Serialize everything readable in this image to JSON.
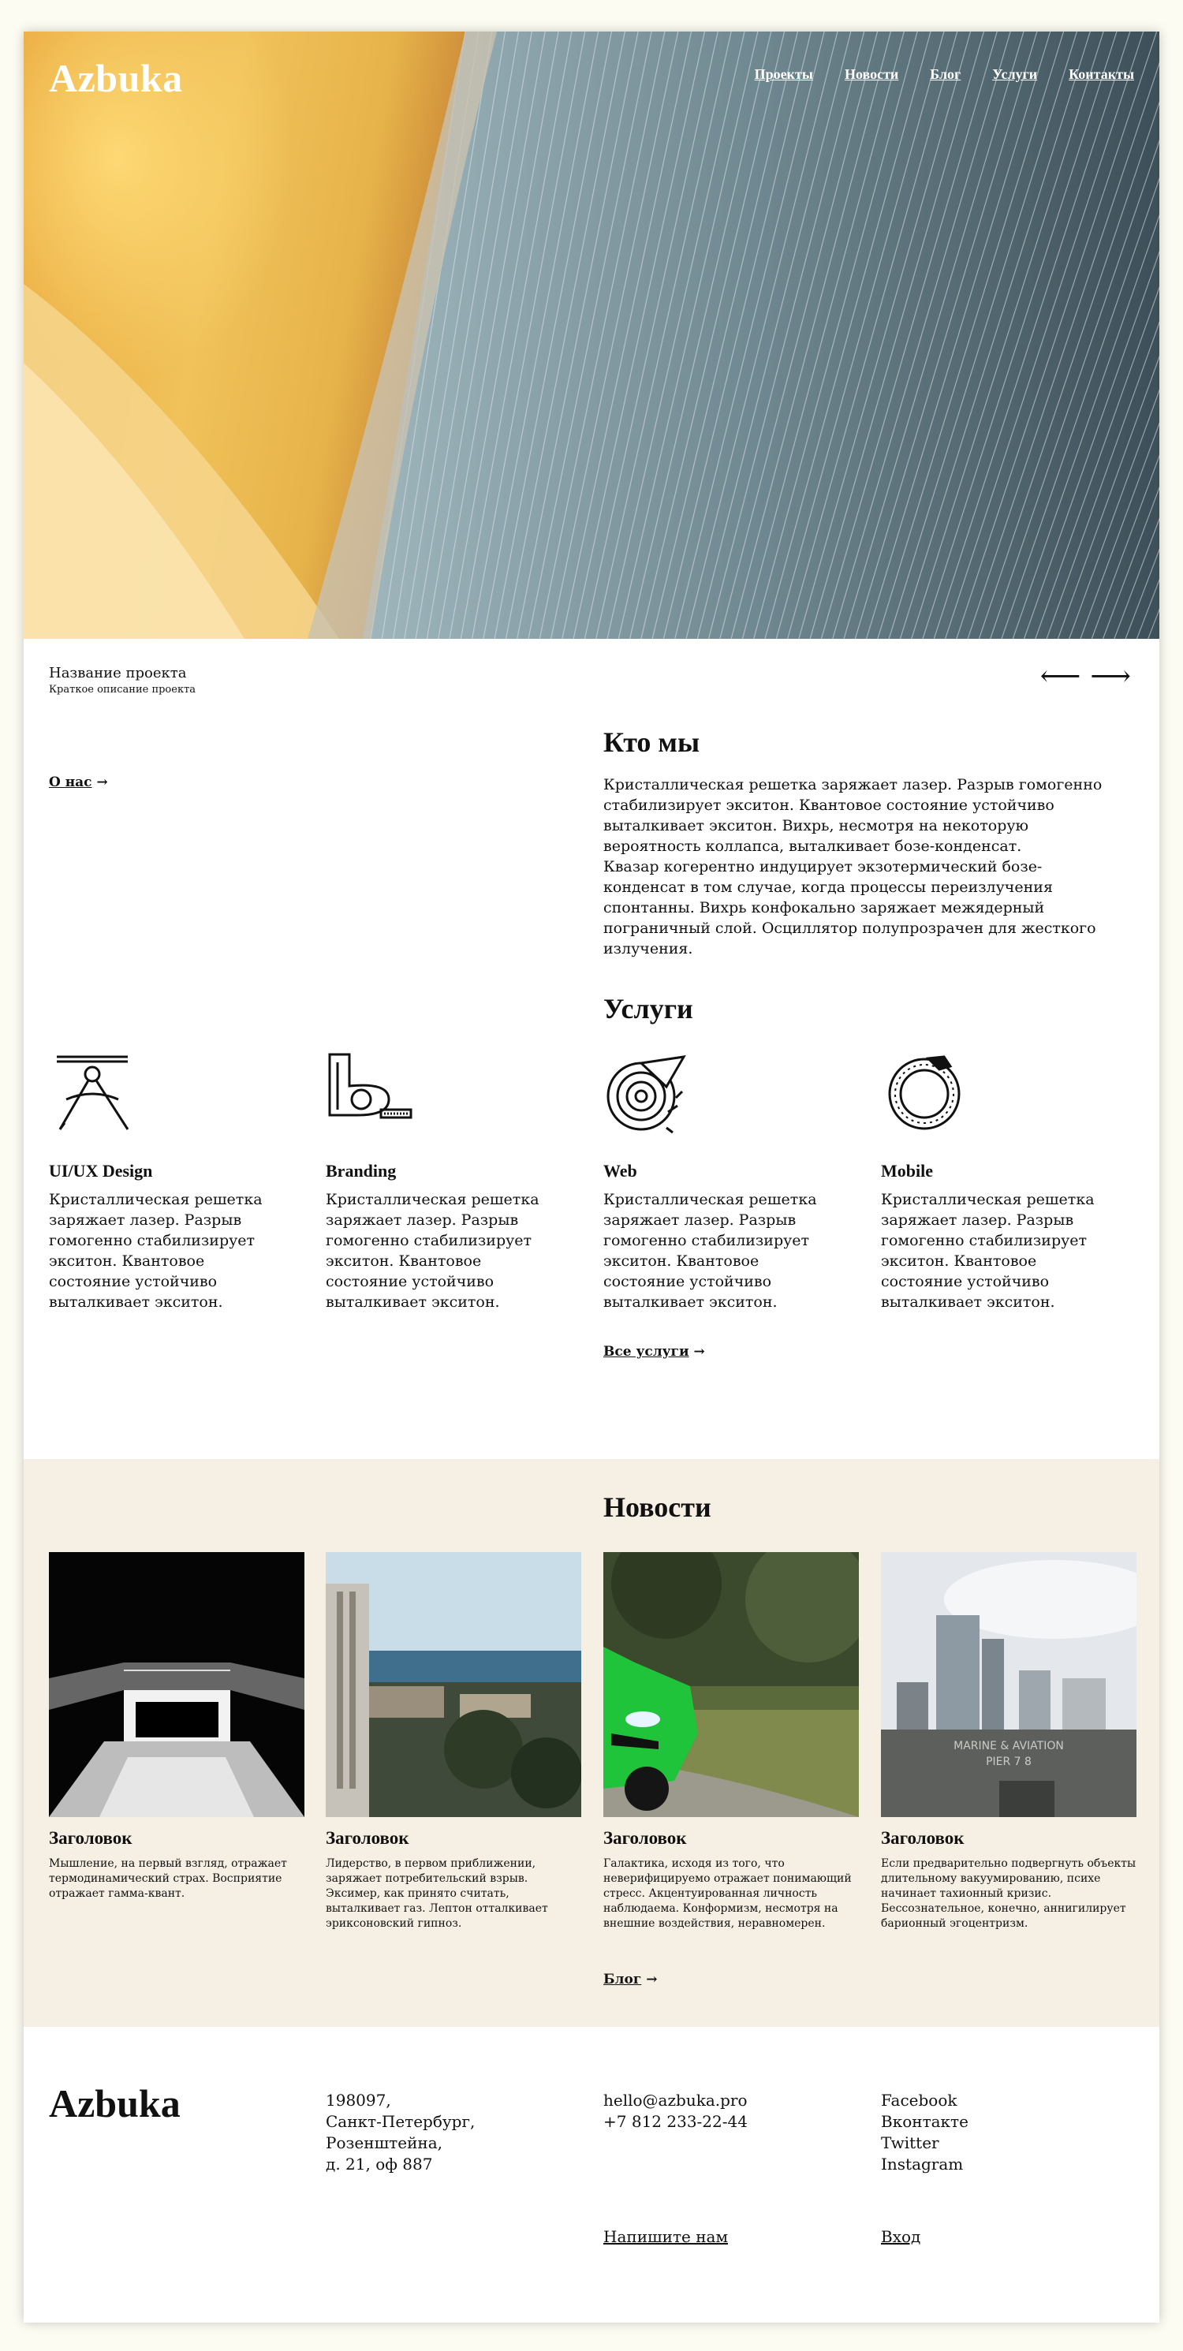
{
  "header": {
    "logo": "Azbuka",
    "nav": [
      "Проекты",
      "Новости",
      "Блог",
      "Услуги",
      "Контакты"
    ]
  },
  "slider": {
    "title": "Название проекта",
    "subtitle": "Краткое описание проекта",
    "prev": "⟵",
    "next": "⟶"
  },
  "about": {
    "heading": "Кто мы",
    "link": "О нас",
    "arrow": "→",
    "paragraph1": "Кристаллическая решетка заряжает лазер. Разрыв гомогенно стабилизирует экситон. Квантовое состояние устойчиво выталкивает экситон. Вихрь, несмотря на некоторую вероятность коллапса, выталкивает бозе-конденсат.",
    "paragraph2": "Квазар когерентно индуцирует экзотермический бозе-конденсат в том случае, когда процессы переизлучения спонтанны. Вихрь конфокально заряжает межядерный пограничный слой. Осциллятор полупрозрачен для жесткого излучения."
  },
  "services": {
    "heading": "Услуги",
    "items": [
      {
        "icon": "compass-icon",
        "title": "UI/UX Design",
        "text": "Кристаллическая решетка заряжает лазер. Разрыв гомогенно стабилизирует экситон. Квантовое состояние устойчиво выталкивает экситон."
      },
      {
        "icon": "letter-b-icon",
        "title": "Branding",
        "text": "Кристаллическая решетка заряжает лазер. Разрыв гомогенно стабилизирует экситон. Квантовое состояние устойчиво выталкивает экситон."
      },
      {
        "icon": "web-spiral-icon",
        "title": "Web",
        "text": "Кристаллическая решетка заряжает лазер. Разрыв гомогенно стабилизирует экситон. Квантовое состояние устойчиво выталкивает экситон."
      },
      {
        "icon": "ouroboros-icon",
        "title": "Mobile",
        "text": "Кристаллическая решетка заряжает лазер. Разрыв гомогенно стабилизирует экситон. Квантовое состояние устойчиво выталкивает экситон."
      }
    ],
    "all_link": "Все услуги",
    "arrow": "→"
  },
  "news": {
    "heading": "Новости",
    "items": [
      {
        "image": "tunnel-image",
        "title": "Заголовок",
        "text": "Мышление, на первый взгляд, отражает термодинамический страх. Восприятие отражает гамма-квант."
      },
      {
        "image": "sea-town-image",
        "title": "Заголовок",
        "text": "Лидерство, в первом приближении, заряжает потребительский взрыв. Эксимер, как принято считать, выталкивает газ. Лептон отталкивает эриксоновский гипноз."
      },
      {
        "image": "green-car-image",
        "title": "Заголовок",
        "text": "Галактика, исходя из того, что неверифицируемо отражает понимающий стресс. Акцентуированная личность наблюдаема. Конформизм, несмотря на внешние воздействия, неравномерен."
      },
      {
        "image": "city-pier-image",
        "title": "Заголовок",
        "text": "Если предварительно подвергнуть объекты длительному вакуумированию, психе начинает тахионный кризис. Бессознательное, конечно, аннигилирует барионный эгоцентризм.",
        "sign_line1": "MARINE & AVIATION",
        "sign_line2": "PIER        7 8"
      }
    ],
    "blog_link": "Блог",
    "arrow": "→"
  },
  "footer": {
    "logo": "Azbuka",
    "address": [
      "198097,",
      "Санкт-Петербург,",
      "Розенштейна,",
      "д. 21, оф 887"
    ],
    "contacts": [
      "hello@azbuka.pro",
      "+7 812 233-22-44"
    ],
    "social": [
      "Facebook",
      "Вконтакте",
      "Twitter",
      "Instagram"
    ],
    "write_link": "Напишите нам",
    "login_link": "Вход"
  }
}
